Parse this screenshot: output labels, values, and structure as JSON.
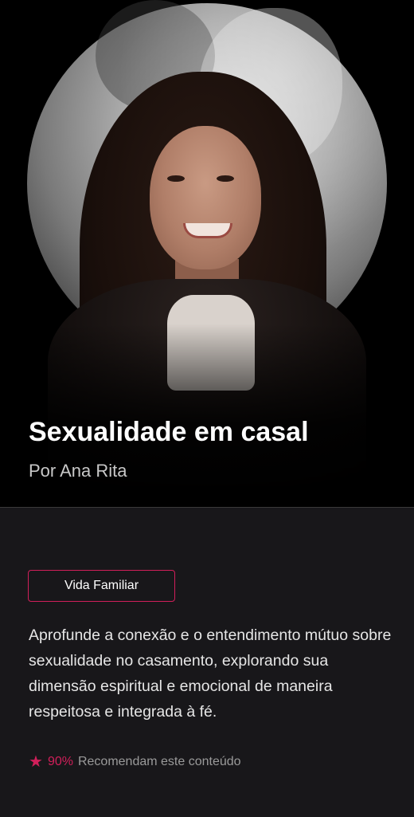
{
  "course": {
    "title": "Sexualidade em casal",
    "author": "Por Ana Rita"
  },
  "details": {
    "tag": "Vida Familiar",
    "description": "Aprofunde a conexão e o entendimento mútuo sobre sexualidade no casamento, explorando sua dimensão espiritual e emocional de maneira respeitosa e integrada à fé.",
    "rating": {
      "icon": "star-icon",
      "percent": "90%",
      "text": "Recomendam este conteúdo"
    }
  },
  "colors": {
    "accent": "#d11f5a",
    "background": "#000000",
    "panel": "#18171a"
  }
}
